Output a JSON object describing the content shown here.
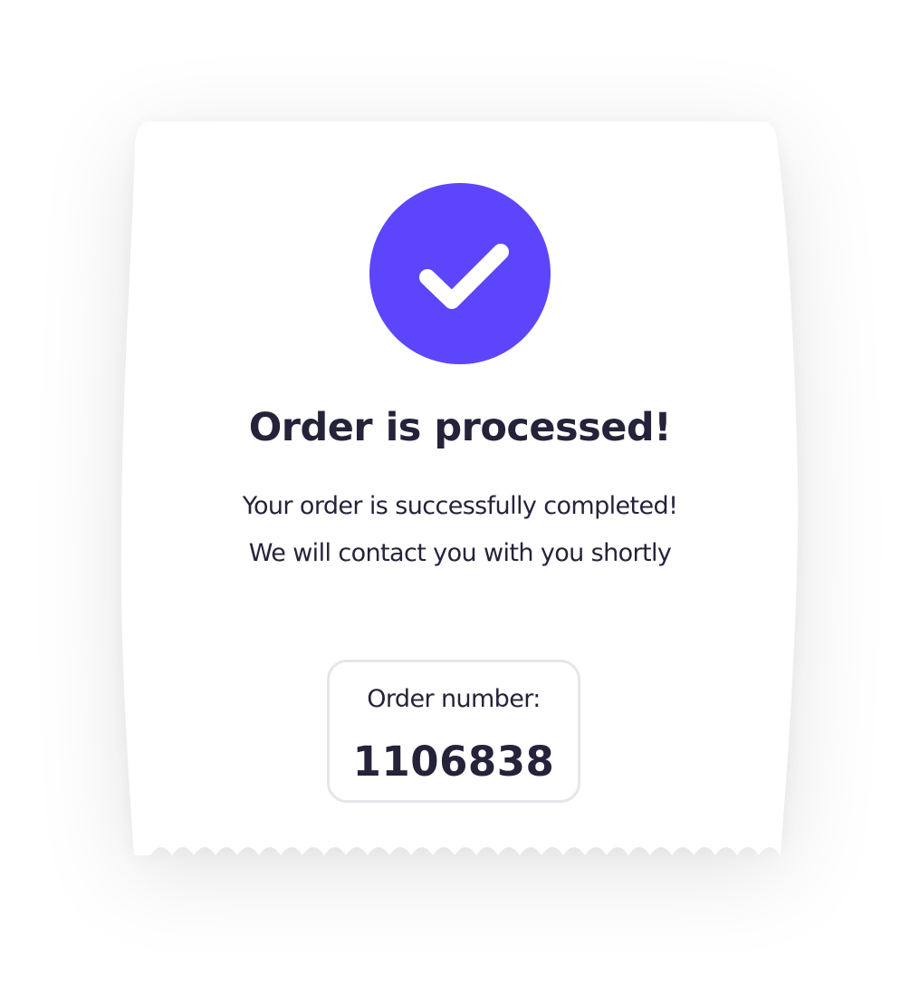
{
  "confirmation": {
    "icon": "check-icon",
    "accent_color": "#5d45fc",
    "title": "Order is processed!",
    "message": "Your order is successfully completed! We will contact you with you shortly",
    "order": {
      "label": "Order number:",
      "number": "1106838"
    }
  }
}
